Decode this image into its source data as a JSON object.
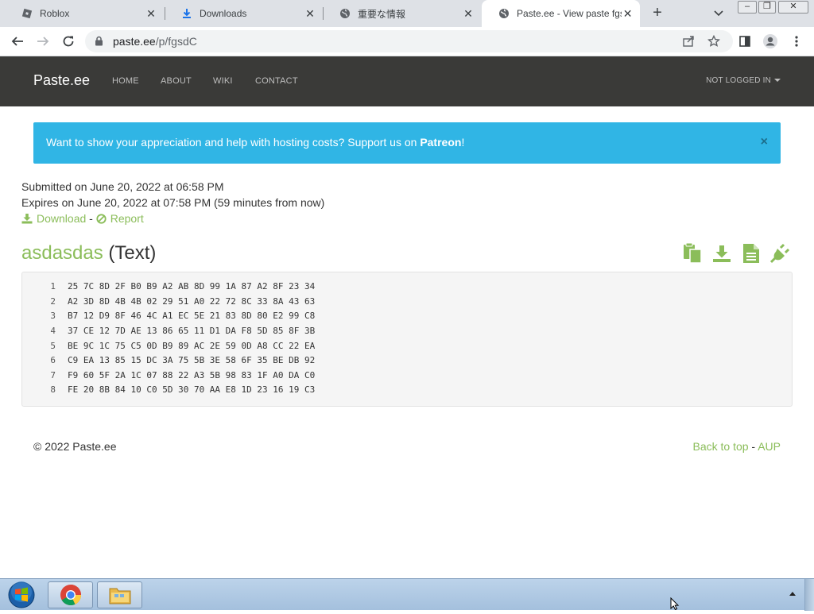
{
  "browser": {
    "tabs": [
      {
        "title": "Roblox",
        "active": false
      },
      {
        "title": "Downloads",
        "active": false
      },
      {
        "title": "重要な情報",
        "active": false
      },
      {
        "title": "Paste.ee - View paste fgsd",
        "active": true
      }
    ],
    "url_host": "paste.ee",
    "url_path": "/p/fgsdC"
  },
  "site": {
    "brand": "Paste.ee",
    "nav": [
      "HOME",
      "ABOUT",
      "WIKI",
      "CONTACT"
    ],
    "account": "NOT LOGGED IN"
  },
  "alert": {
    "message": "Want to show your appreciation and help with hosting costs? Support us on ",
    "link": "Patreon",
    "suffix": "!",
    "close": "×"
  },
  "paste": {
    "submitted": "Submitted on June 20, 2022 at 06:58 PM",
    "expires": "Expires on June 20, 2022 at 07:58 PM (59 minutes from now)",
    "download_label": "Download",
    "report_label": "Report",
    "link_separator": " - ",
    "name": "asdasdas",
    "type": "(Text)",
    "lines": [
      {
        "n": "1",
        "text": "25 7C 8D 2F B0 B9 A2 AB 8D 99 1A 87 A2 8F 23 34"
      },
      {
        "n": "2",
        "text": "A2 3D 8D 4B 4B 02 29 51 A0 22 72 8C 33 8A 43 63"
      },
      {
        "n": "3",
        "text": "B7 12 D9 8F 46 4C A1 EC 5E 21 83 8D 80 E2 99 C8"
      },
      {
        "n": "4",
        "text": "37 CE 12 7D AE 13 86 65 11 D1 DA F8 5D 85 8F 3B"
      },
      {
        "n": "5",
        "text": "BE 9C 1C 75 C5 0D B9 89 AC 2E 59 0D A8 CC 22 EA"
      },
      {
        "n": "6",
        "text": "C9 EA 13 85 15 DC 3A 75 5B 3E 58 6F 35 BE DB 92"
      },
      {
        "n": "7",
        "text": "F9 60 5F 2A 1C 07 88 22 A3 5B 98 83 1F A0 DA C0"
      },
      {
        "n": "8",
        "text": "FE 20 8B 84 10 C0 5D 30 70 AA E8 1D 23 16 19 C3"
      }
    ]
  },
  "footer": {
    "copyright": "© 2022 Paste.ee",
    "back_to_top": "Back to top",
    "separator": " - ",
    "aup": "AUP"
  },
  "colors": {
    "accent_green": "#8bbd5a",
    "navbar": "#3a3a38",
    "alert": "#30b5e5"
  }
}
